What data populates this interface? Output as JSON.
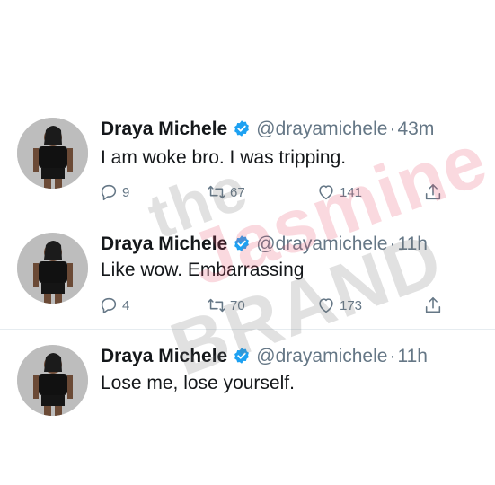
{
  "watermark": {
    "line1": "the",
    "line2": "Jasmine",
    "line3": "BRAND"
  },
  "tweets": [
    {
      "name": "Draya Michele",
      "handle": "@drayamichele",
      "separator": "·",
      "time": "43m",
      "text": "I am woke bro.  I was tripping.",
      "replies": "9",
      "retweets": "67",
      "likes": "141"
    },
    {
      "name": "Draya Michele",
      "handle": "@drayamichele",
      "separator": "·",
      "time": "11h",
      "text": "Like wow.  Embarrassing",
      "replies": "4",
      "retweets": "70",
      "likes": "173"
    },
    {
      "name": "Draya Michele",
      "handle": "@drayamichele",
      "separator": "·",
      "time": "11h",
      "text": "Lose me, lose yourself."
    }
  ],
  "colors": {
    "verified_badge": "#1da1f2",
    "secondary_text": "#657786",
    "divider": "#e6ecf0",
    "watermark_pink": "#e8506e"
  },
  "icons": [
    "reply-icon",
    "retweet-icon",
    "like-icon",
    "share-icon",
    "verified-icon"
  ]
}
